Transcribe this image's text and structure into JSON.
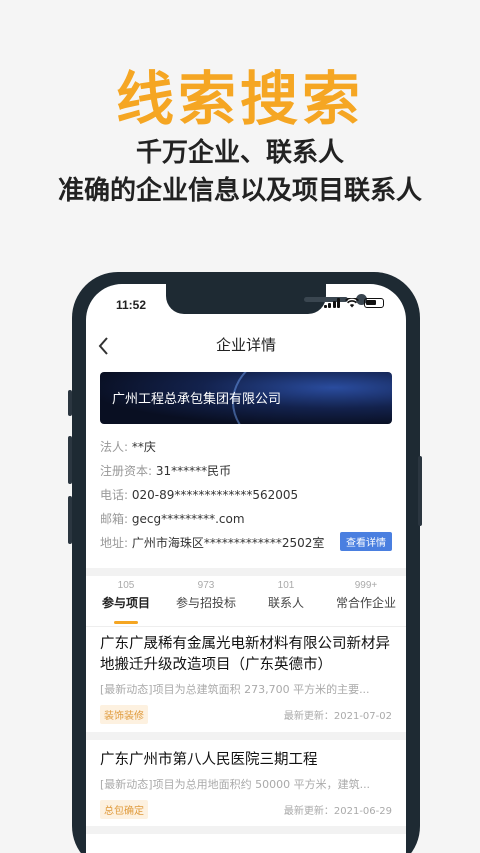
{
  "hero": {
    "title": "线索搜索",
    "subtitle_line1": "千万企业、联系人",
    "subtitle_line2": "准确的企业信息以及项目联系人"
  },
  "status_bar": {
    "time": "11:52"
  },
  "nav": {
    "title": "企业详情",
    "back_icon": "chevron-left-icon"
  },
  "company": {
    "name": "广州工程总承包集团有限公司",
    "legal_label": "法人:",
    "legal_value": "**庆",
    "capital_label": "注册资本:",
    "capital_value": "31******民币",
    "phone_label": "电话:",
    "phone_value": "020-89*************562005",
    "email_label": "邮箱:",
    "email_value": "gecg*********.com",
    "address_label": "地址:",
    "address_value": "广州市海珠区*************2502室",
    "detail_button": "查看详情"
  },
  "tabs": [
    {
      "count": "105",
      "label": "参与项目",
      "active": true
    },
    {
      "count": "973",
      "label": "参与招投标"
    },
    {
      "count": "101",
      "label": "联系人"
    },
    {
      "count": "999+",
      "label": "常合作企业"
    }
  ],
  "projects": [
    {
      "title": "广东广晟稀有金属光电新材料有限公司新材异地搬迁升级改造项目（广东英德市）",
      "desc": "[最新动态]项目为总建筑面积 273,700 平方米的主要...",
      "tag": "装饰装修",
      "date": "最新更新：2021-07-02"
    },
    {
      "title": "广东广州市第八人民医院三期工程",
      "desc": "[最新动态]项目为总用地面积约 50000 平方米，建筑...",
      "tag": "总包确定",
      "date": "最新更新：2021-06-29"
    }
  ],
  "colors": {
    "accent": "#f5a623",
    "link_blue": "#4a7fe0",
    "phone_frame": "#1e2a33"
  }
}
